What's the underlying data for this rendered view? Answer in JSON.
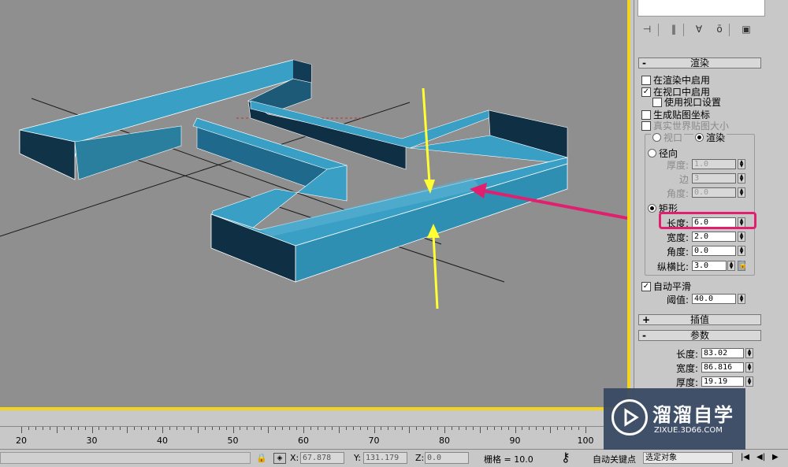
{
  "render_rollout": {
    "label": "渲染",
    "sign": "-"
  },
  "render_options": {
    "enable_in_renderer": {
      "label": "在渲染中启用",
      "checked": false
    },
    "enable_in_viewport": {
      "label": "在视口中启用",
      "checked": true
    },
    "use_viewport_settings": {
      "label": "使用视口设置",
      "checked": false
    },
    "generate_mapping": {
      "label": "生成贴图坐标",
      "checked": false
    },
    "real_world_map": {
      "label": "真实世界贴图大小",
      "checked": false
    }
  },
  "mode_radios": {
    "viewport": "视口",
    "render": "渲染"
  },
  "radial": {
    "label": "径向",
    "thickness": {
      "label": "厚度:",
      "value": "1.0"
    },
    "sides": {
      "label": "边",
      "value": "3"
    },
    "angle": {
      "label": "角度:",
      "value": "0.0"
    }
  },
  "rectangular": {
    "label": "矩形",
    "length": {
      "label": "长度:",
      "value": "6.0"
    },
    "width": {
      "label": "宽度:",
      "value": "2.0"
    },
    "angle": {
      "label": "角度:",
      "value": "0.0"
    },
    "aspect": {
      "label": "纵横比:",
      "value": "3.0"
    }
  },
  "auto_smooth": {
    "label": "自动平滑",
    "checked": true,
    "threshold_label": "阈值:",
    "threshold_value": "40.0"
  },
  "interpolation_rollout": {
    "label": "插值",
    "sign": "+"
  },
  "params_rollout": {
    "label": "参数",
    "sign": "-"
  },
  "params": {
    "length": {
      "label": "长度:",
      "value": "83.02"
    },
    "width": {
      "label": "宽度:",
      "value": "86.816"
    },
    "thickness": {
      "label": "厚度:",
      "value": "19.19"
    }
  },
  "timeline": {
    "ticks": [
      "20",
      "30",
      "40",
      "50",
      "60",
      "70",
      "80",
      "90",
      "100"
    ]
  },
  "status": {
    "x_label": "X:",
    "x_value": "67.878",
    "y_label": "Y:",
    "y_value": "131.179",
    "z_label": "Z:",
    "z_value": "0.0",
    "grid": "栅格 = 10.0",
    "auto_key": "自动关键点",
    "selection": "选定对象"
  },
  "watermark": {
    "title": "溜溜自学",
    "url": "ZIXUE.3D66.COM"
  },
  "colors": {
    "viewport_bg": "#8f8f8f",
    "active_border": "#f4d31c",
    "object": "#2f8fb3",
    "highlight": "#e0206e",
    "arrow": "#ffff33"
  }
}
